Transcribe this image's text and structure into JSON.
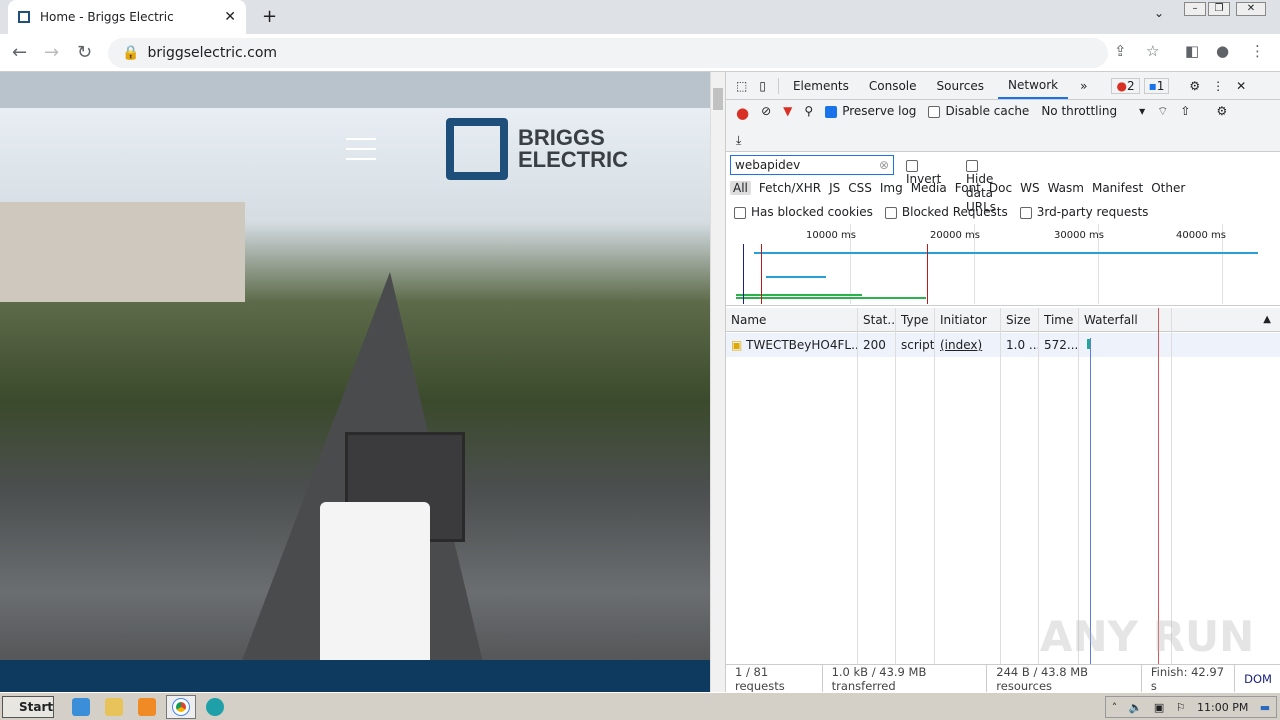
{
  "browser": {
    "tab_title": "Home - Briggs Electric",
    "url": "briggselectric.com"
  },
  "page": {
    "logo_line1": "BRIGGS",
    "logo_line2": "ELECTRIC"
  },
  "devtools": {
    "tabs": [
      "Elements",
      "Console",
      "Sources",
      "Network"
    ],
    "more": "»",
    "errors": "2",
    "messages": "1",
    "preserve_log": "Preserve log",
    "disable_cache": "Disable cache",
    "throttling": "No throttling",
    "filter_value": "webapidev",
    "invert": "Invert",
    "hide_data_urls": "Hide data URLs",
    "type_filters": [
      "All",
      "Fetch/XHR",
      "JS",
      "CSS",
      "Img",
      "Media",
      "Font",
      "Doc",
      "WS",
      "Wasm",
      "Manifest",
      "Other"
    ],
    "has_blocked_cookies": "Has blocked cookies",
    "blocked_requests": "Blocked Requests",
    "third_party": "3rd-party requests",
    "ticks": [
      "10000 ms",
      "20000 ms",
      "30000 ms",
      "40000 ms"
    ],
    "columns": [
      "Name",
      "Stat...",
      "Type",
      "Initiator",
      "Size",
      "Time",
      "Waterfall"
    ],
    "rows": [
      {
        "name": "TWECTBeyHO4FL...",
        "status": "200",
        "type": "script",
        "initiator": "(index)",
        "size": "1.0 ...",
        "time": "572..."
      }
    ],
    "status": {
      "requests": "1 / 81 requests",
      "transferred": "1.0 kB / 43.9 MB transferred",
      "resources": "244 B / 43.8 MB resources",
      "finish": "Finish: 42.97 s",
      "dom": "DOM"
    }
  },
  "taskbar": {
    "start": "Start",
    "clock": "11:00 PM"
  },
  "watermark": "ANY RUN"
}
